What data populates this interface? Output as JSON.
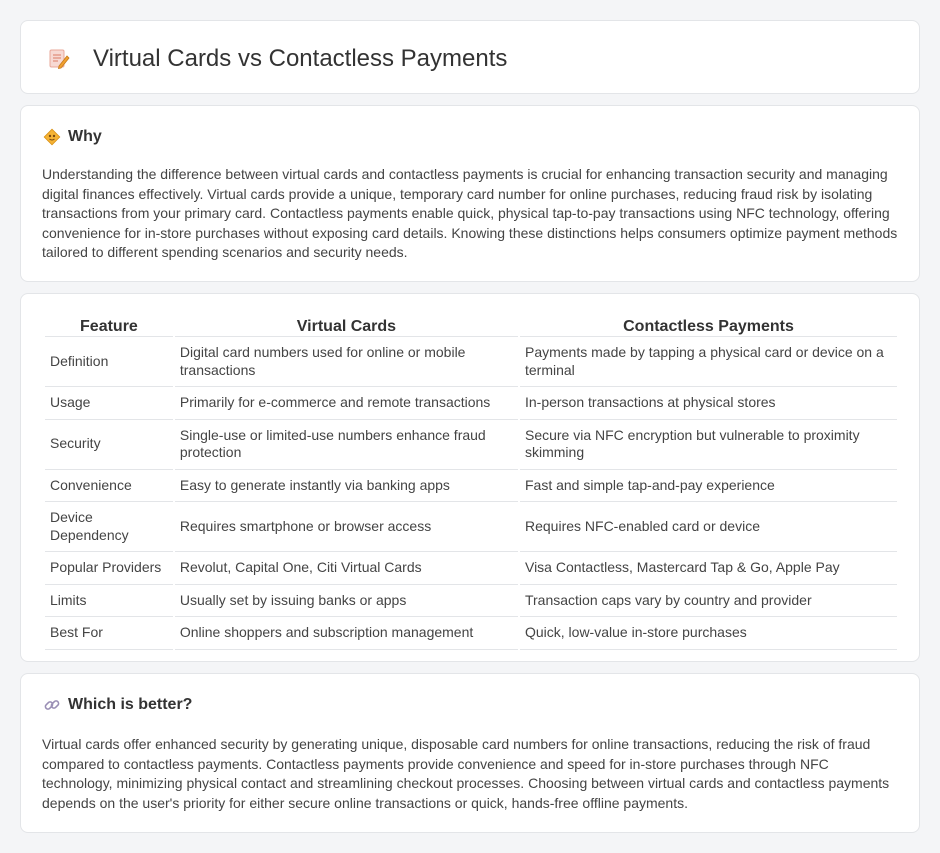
{
  "header": {
    "title": "Virtual Cards vs Contactless Payments",
    "icon": "document-pencil-icon"
  },
  "why": {
    "title": "Why",
    "icon": "diamond-sign-icon",
    "body": "Understanding the difference between virtual cards and contactless payments is crucial for enhancing transaction security and managing digital finances effectively. Virtual cards provide a unique, temporary card number for online purchases, reducing fraud risk by isolating transactions from your primary card. Contactless payments enable quick, physical tap-to-pay transactions using NFC technology, offering convenience for in-store purchases without exposing card details. Knowing these distinctions helps consumers optimize payment methods tailored to different spending scenarios and security needs."
  },
  "table": {
    "headers": [
      "Feature",
      "Virtual Cards",
      "Contactless Payments"
    ],
    "rows": [
      [
        "Definition",
        "Digital card numbers used for online or mobile transactions",
        "Payments made by tapping a physical card or device on a terminal"
      ],
      [
        "Usage",
        "Primarily for e-commerce and remote transactions",
        "In-person transactions at physical stores"
      ],
      [
        "Security",
        "Single-use or limited-use numbers enhance fraud protection",
        "Secure via NFC encryption but vulnerable to proximity skimming"
      ],
      [
        "Convenience",
        "Easy to generate instantly via banking apps",
        "Fast and simple tap-and-pay experience"
      ],
      [
        "Device Dependency",
        "Requires smartphone or browser access",
        "Requires NFC-enabled card or device"
      ],
      [
        "Popular Providers",
        "Revolut, Capital One, Citi Virtual Cards",
        "Visa Contactless, Mastercard Tap & Go, Apple Pay"
      ],
      [
        "Limits",
        "Usually set by issuing banks or apps",
        "Transaction caps vary by country and provider"
      ],
      [
        "Best For",
        "Online shoppers and subscription management",
        "Quick, low-value in-store purchases"
      ]
    ]
  },
  "better": {
    "title": "Which is better?",
    "icon": "link-icon",
    "body": "Virtual cards offer enhanced security by generating unique, disposable card numbers for online transactions, reducing the risk of fraud compared to contactless payments. Contactless payments provide convenience and speed for in-store purchases through NFC technology, minimizing physical contact and streamlining checkout processes. Choosing between virtual cards and contactless payments depends on the user's priority for either secure online transactions or quick, hands-free offline payments."
  }
}
